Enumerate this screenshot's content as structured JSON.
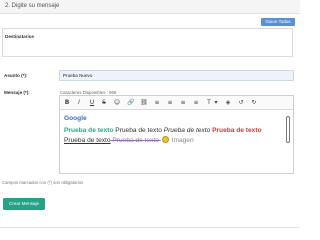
{
  "panel": {
    "title": "2. Digite su mensaje"
  },
  "actions": {
    "guion_label": "Guion Todos",
    "crear_label": "Crear Mensaje"
  },
  "form": {
    "destinatarios_label": "Destinatarios",
    "asunto_label": "Asunto (*):",
    "asunto_value": "Prueba Nuevo",
    "mensaje_label": "Mensaje (*):",
    "chars_text": "Caracteres Disponibles : 966",
    "note": "Campos marcados con (*) son obligatorios"
  },
  "editor": {
    "toolbar": [
      "B",
      "I",
      "U",
      "S",
      "☺",
      "🔗",
      "⛓",
      "≡",
      "≡",
      "≡",
      "≡",
      "T",
      "▾",
      "◈",
      "↺",
      "↻"
    ],
    "content": {
      "heading": "Google",
      "line1": {
        "a": "Prueba de texto",
        "b": " Prueba de texto ",
        "c": "Prueba de texto",
        "d": " Prueba de texto"
      },
      "line2": {
        "a": "Prueba de texto",
        "b": " Prueba de texto ",
        "c": " Imagen"
      }
    }
  },
  "colors": {
    "button_blue": "#5b8fd4",
    "button_green": "#26a287",
    "link_blue": "#3a6db5",
    "text_green": "#2aa58a",
    "text_red": "#c23b3b"
  }
}
